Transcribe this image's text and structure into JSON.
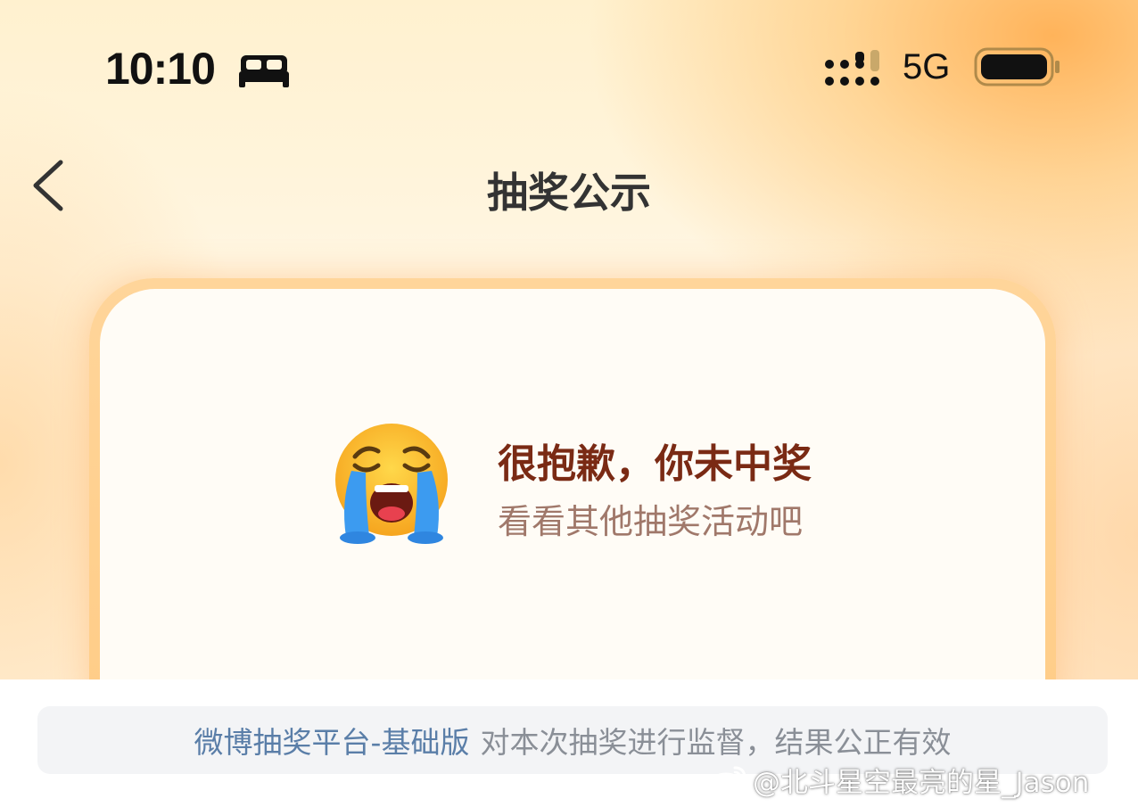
{
  "status_bar": {
    "time": "10:10",
    "network": "5G",
    "icons": [
      "bed-icon",
      "signal-icon",
      "battery-icon"
    ]
  },
  "nav": {
    "back_icon": "chevron-left-icon",
    "title": "抽奖公示"
  },
  "result": {
    "emoji": "loudly-crying-face",
    "title": "很抱歉，你未中奖",
    "subtitle": "看看其他抽奖活动吧"
  },
  "footer": {
    "platform_link": "微博抽奖平台-基础版",
    "notice": "对本次抽奖进行监督，结果公正有效"
  },
  "watermark": {
    "text": "@北斗星空最亮的星_Jason",
    "logo": "weibo-logo-icon"
  },
  "colors": {
    "title_brown": "#7a2a14",
    "subtitle_brown": "#a0786a",
    "link_blue": "#5a7ea8",
    "card_border": "#ffd59a"
  }
}
